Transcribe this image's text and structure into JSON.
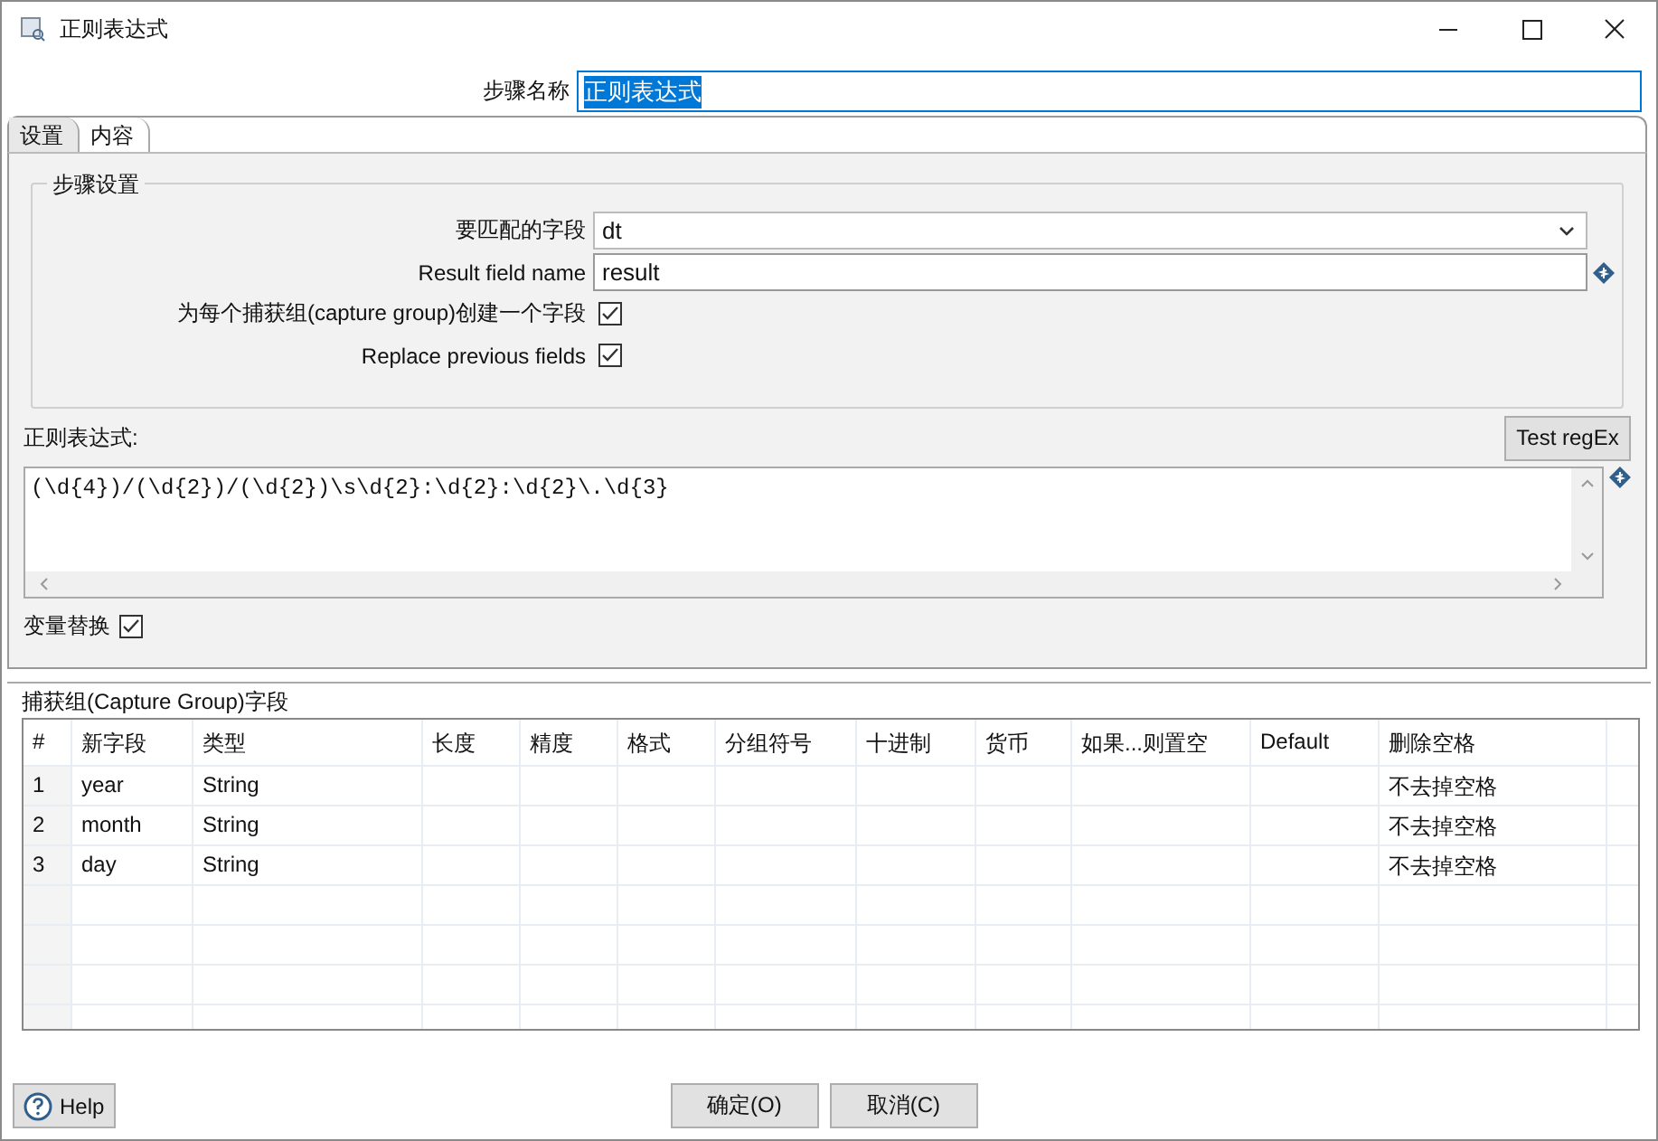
{
  "window": {
    "title": "正则表达式"
  },
  "step_name": {
    "label": "步骤名称",
    "value": "正则表达式"
  },
  "tabs": [
    {
      "label": "设置",
      "selected": true
    },
    {
      "label": "内容",
      "selected": false
    }
  ],
  "settings_group": {
    "title": "步骤设置",
    "fields": [
      {
        "kind": "dropdown",
        "label": "要匹配的字段",
        "value": "dt"
      },
      {
        "kind": "text",
        "label": "Result field name",
        "value": "result"
      },
      {
        "kind": "checkbox",
        "label": "为每个捕获组(capture group)创建一个字段",
        "checked": true
      },
      {
        "kind": "checkbox",
        "label": "Replace previous fields",
        "checked": true
      }
    ]
  },
  "regex": {
    "label": "正则表达式:",
    "test_button": "Test regEx",
    "value": "(\\d{4})/(\\d{2})/(\\d{2})\\s\\d{2}:\\d{2}:\\d{2}\\.\\d{3}",
    "variable_substitution": {
      "label": "变量替换",
      "checked": true
    }
  },
  "capture_section": {
    "title": "捕获组(Capture Group)字段",
    "columns": [
      "#",
      "新字段",
      "类型",
      "长度",
      "精度",
      "格式",
      "分组符号",
      "十进制",
      "货币",
      "如果...则置空",
      "Default",
      "删除空格"
    ],
    "rows": [
      [
        "1",
        "year",
        "String",
        "",
        "",
        "",
        "",
        "",
        "",
        "",
        "",
        "不去掉空格"
      ],
      [
        "2",
        "month",
        "String",
        "",
        "",
        "",
        "",
        "",
        "",
        "",
        "",
        "不去掉空格"
      ],
      [
        "3",
        "day",
        "String",
        "",
        "",
        "",
        "",
        "",
        "",
        "",
        "",
        "不去掉空格"
      ]
    ]
  },
  "buttons": {
    "help": "Help",
    "ok": "确定(O)",
    "cancel": "取消(C)"
  }
}
